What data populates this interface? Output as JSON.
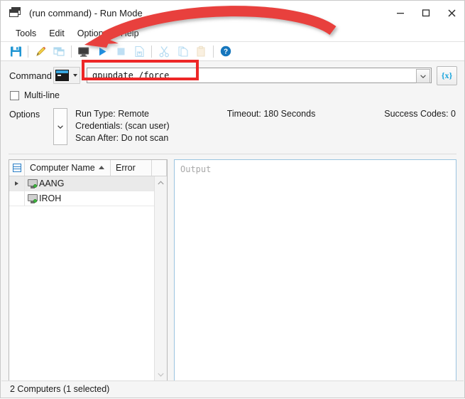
{
  "window": {
    "title": "(run command) - Run Mode",
    "icon": "cascade-windows-icon",
    "controls": {
      "minimize": "minimize-icon",
      "maximize": "maximize-icon",
      "close": "close-icon"
    }
  },
  "menubar": {
    "items": [
      {
        "label": "Tools"
      },
      {
        "label": "Edit"
      },
      {
        "label": "Options"
      },
      {
        "label": "Help"
      }
    ]
  },
  "toolbar": {
    "buttons": [
      {
        "name": "save-icon",
        "enabled": true
      },
      {
        "name": "edit-pencil-icon",
        "enabled": true
      },
      {
        "name": "duplicate-window-icon",
        "enabled": false
      },
      {
        "name": "monitor-icon",
        "enabled": true
      },
      {
        "name": "run-play-icon",
        "enabled": true
      },
      {
        "name": "stop-icon",
        "enabled": false
      },
      {
        "name": "save-file-icon",
        "enabled": false
      },
      {
        "name": "cut-icon",
        "enabled": false
      },
      {
        "name": "copy-icon",
        "enabled": false
      },
      {
        "name": "paste-icon",
        "enabled": false
      },
      {
        "name": "help-icon",
        "enabled": true
      }
    ]
  },
  "command": {
    "label": "Command",
    "type_icon": "console-window-icon",
    "value": "gpupdate /force",
    "dropdown_icon": "chevron-down-icon",
    "variable_button_label": "{x}",
    "highlight_color": "#ed2727"
  },
  "multiline": {
    "label": "Multi-line",
    "checked": false
  },
  "options": {
    "label": "Options",
    "expand_icon": "chevron-down-icon",
    "lines": [
      "Run Type: Remote",
      "Credentials: (scan user)",
      "Scan After: Do not scan"
    ],
    "timeout": "Timeout: 180 Seconds",
    "success_codes": "Success Codes: 0"
  },
  "computer_list": {
    "columns": [
      {
        "label": "Computer Name",
        "sorted": "asc"
      },
      {
        "label": "Error",
        "sorted": "none"
      }
    ],
    "rows": [
      {
        "name": "AANG",
        "error": "",
        "selected": true,
        "status": "online",
        "expandable": true
      },
      {
        "name": "IROH",
        "error": "",
        "selected": false,
        "status": "online",
        "expandable": false
      }
    ],
    "scroll_up_icon": "chevron-up-icon",
    "scroll_left_icon": "chevron-left-icon",
    "scroll_right_icon": "chevron-right-icon"
  },
  "output": {
    "placeholder": "Output",
    "value": ""
  },
  "statusbar": {
    "text": "2 Computers (1 selected)"
  },
  "annotation": {
    "arrow_color": "#e8413c",
    "arrow_target": "run-play-icon"
  }
}
